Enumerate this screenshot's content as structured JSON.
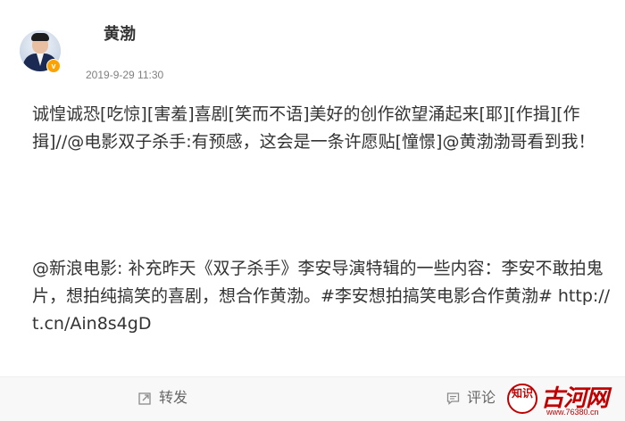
{
  "post": {
    "author": "黄渤",
    "verified_badge": "v",
    "time": "2019-9-29 11:30",
    "text": "诚惶诚恐[吃惊][害羞]喜剧[笑而不语]美好的创作欲望涌起来[耶][作揖][作揖]//@电影双子杀手:有预感，这会是一条许愿贴[憧憬]@黄渤渤哥看到我！",
    "repost_text": "@新浪电影: 补充昨天《双子杀手》李安导演特辑的一些内容：李安不敢拍鬼片，想拍纯搞笑的喜剧，想合作黄渤。#李安想拍搞笑电影合作黄渤# http://t.cn/Ain8s4gD"
  },
  "actions": {
    "forward": {
      "label": "转发",
      "icon": "forward-icon"
    },
    "comment": {
      "label": "评论",
      "icon": "comment-icon"
    }
  },
  "watermark": {
    "badge": "知识",
    "name": "古河网",
    "url": "www.76380.cn"
  },
  "colors": {
    "text": "#333333",
    "meta": "#808080",
    "footer_bg": "#f8f8f8",
    "verified": "#ffa200",
    "watermark": "#c00000"
  }
}
